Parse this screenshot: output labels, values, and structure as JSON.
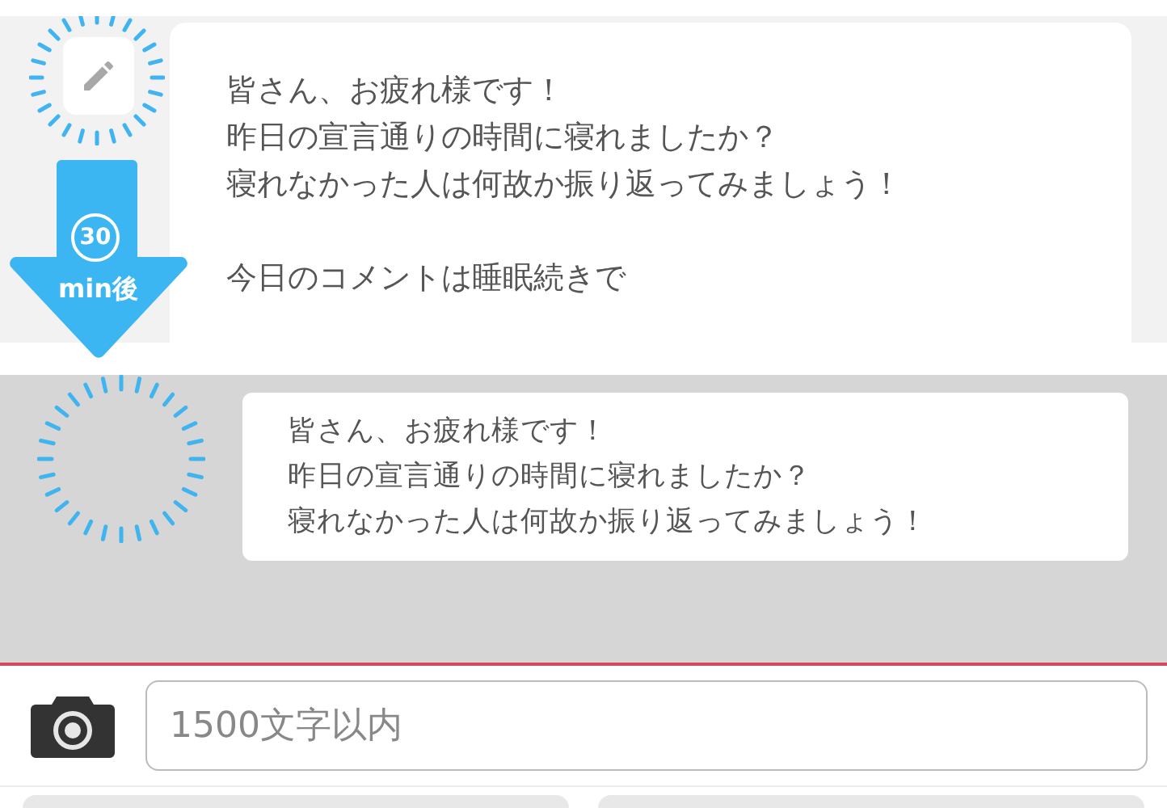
{
  "original_message": {
    "paragraphs": [
      [
        "皆さん、お疲れ様です！",
        "昨日の宣言通りの時間に寝れましたか？",
        "寝れなかった人は何故か振り返ってみましょう！"
      ],
      [
        "今日のコメントは睡眠続きで"
      ]
    ]
  },
  "delay_arrow": {
    "number": "30",
    "unit": "min後"
  },
  "preview_message": {
    "lines": [
      "皆さん、お疲れ様です！",
      "昨日の宣言通りの時間に寝れましたか？",
      "寝れなかった人は何故か振り返ってみましょう！"
    ]
  },
  "composer": {
    "placeholder": "1500文字以内"
  }
}
